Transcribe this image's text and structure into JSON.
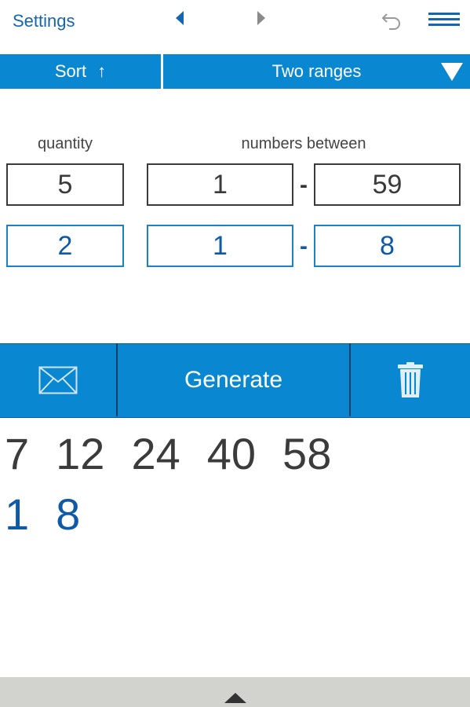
{
  "topbar": {
    "settings_label": "Settings"
  },
  "selector": {
    "sort_label": "Sort",
    "sort_arrow": "↑",
    "range_label": "Two ranges"
  },
  "labels": {
    "quantity": "quantity",
    "numbers_between": "numbers between"
  },
  "range1": {
    "quantity": "5",
    "from": "1",
    "to": "59",
    "separator": "-"
  },
  "range2": {
    "quantity": "2",
    "from": "1",
    "to": "8",
    "separator": "-"
  },
  "actions": {
    "generate_label": "Generate",
    "mail_icon": "envelope-icon",
    "trash_icon": "trash-icon"
  },
  "results": {
    "range1": [
      "7",
      "12",
      "24",
      "40",
      "58"
    ],
    "range2": [
      "1",
      "8"
    ]
  },
  "colors": {
    "accent": "#0a87d1",
    "blue_text": "#0e5aa8",
    "dark_text": "#3b3b3b",
    "bottom_strip": "#d2d2ce"
  }
}
